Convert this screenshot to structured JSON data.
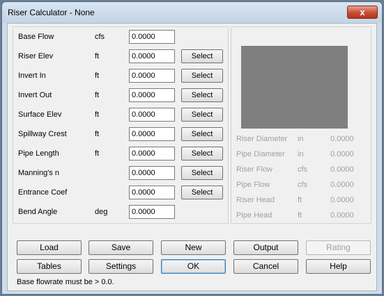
{
  "window": {
    "title": "Riser Calculator - None",
    "close_glyph": "x"
  },
  "inputs": [
    {
      "label": "Base Flow",
      "unit": "cfs",
      "value": "0.0000",
      "select": false
    },
    {
      "label": "Riser Elev",
      "unit": "ft",
      "value": "0.0000",
      "select": true
    },
    {
      "label": "Invert In",
      "unit": "ft",
      "value": "0.0000",
      "select": true
    },
    {
      "label": "Invert Out",
      "unit": "ft",
      "value": "0.0000",
      "select": true
    },
    {
      "label": "Surface Elev",
      "unit": "ft",
      "value": "0.0000",
      "select": true
    },
    {
      "label": "Spillway Crest",
      "unit": "ft",
      "value": "0.0000",
      "select": true
    },
    {
      "label": "Pipe Length",
      "unit": "ft",
      "value": "0.0000",
      "select": true
    },
    {
      "label": "Manning's n",
      "unit": "",
      "value": "0.0000",
      "select": true
    },
    {
      "label": "Entrance Coef",
      "unit": "",
      "value": "0.0000",
      "select": true
    },
    {
      "label": "Bend Angle",
      "unit": "deg",
      "value": "0.0000",
      "select": false
    }
  ],
  "select_label": "Select",
  "results": [
    {
      "label": "Riser Diameter",
      "unit": "in",
      "value": "0.0000"
    },
    {
      "label": "Pipe Diameter",
      "unit": "in",
      "value": "0.0000"
    },
    {
      "label": "Riser Flow",
      "unit": "cfs",
      "value": "0.0000"
    },
    {
      "label": "Pipe Flow",
      "unit": "cfs",
      "value": "0.0000"
    },
    {
      "label": "Riser Head",
      "unit": "ft",
      "value": "0.0000"
    },
    {
      "label": "Pipe Head",
      "unit": "ft",
      "value": "0.0000"
    }
  ],
  "buttons": {
    "load": "Load",
    "save": "Save",
    "new": "New",
    "output": "Output",
    "rating": "Rating",
    "tables": "Tables",
    "settings": "Settings",
    "ok": "OK",
    "cancel": "Cancel",
    "help": "Help"
  },
  "status_text": "Base flowrate must be > 0.0."
}
